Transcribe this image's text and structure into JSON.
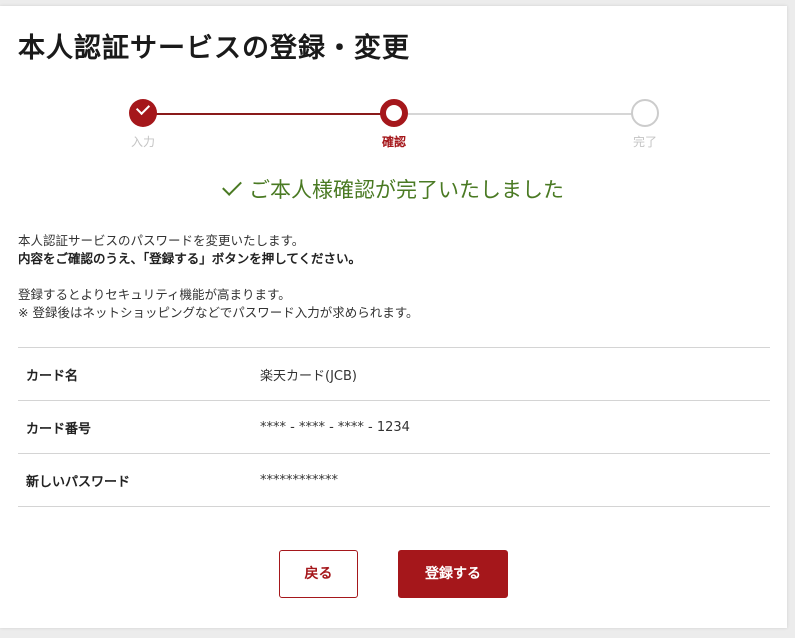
{
  "page": {
    "title": "本人認証サービスの登録・変更"
  },
  "stepper": {
    "steps": [
      {
        "label": "入力",
        "state": "done"
      },
      {
        "label": "確認",
        "state": "current"
      },
      {
        "label": "完了",
        "state": "todo"
      }
    ]
  },
  "confirmation": {
    "message": "ご本人様確認が完了いたしました"
  },
  "description": {
    "line1": "本人認証サービスのパスワードを変更いたします。",
    "line2": "内容をご確認のうえ、「登録する」ボタンを押してください。",
    "line3": "登録するとよりセキュリティ機能が高まります。",
    "line4": "※ 登録後はネットショッピングなどでパスワード入力が求められます。"
  },
  "details": {
    "rows": [
      {
        "label": "カード名",
        "value": "楽天カード(JCB)"
      },
      {
        "label": "カード番号",
        "value": "**** - **** - **** - 1234"
      },
      {
        "label": "新しいパスワード",
        "value": "************"
      }
    ]
  },
  "buttons": {
    "back_label": "戻る",
    "submit_label": "登録する"
  },
  "colors": {
    "accent": "#a5171b",
    "success": "#4a7a23",
    "inactive": "#cccccc"
  }
}
